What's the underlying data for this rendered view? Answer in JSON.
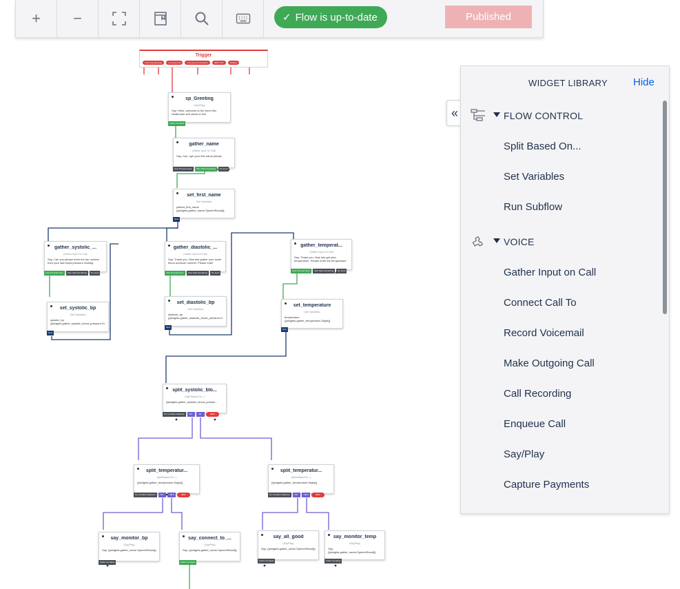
{
  "toolbar": {
    "buttons": [
      "zoom-in",
      "zoom-out",
      "fit-to-screen",
      "notes",
      "search",
      "keyboard-shortcuts"
    ],
    "zoom_in_glyph": "+",
    "zoom_out_glyph": "−",
    "status_check": "✓",
    "status": "Flow is up-to-date",
    "publish_label": "Published",
    "status_color": "#3fa956",
    "publish_color": "#eeb2b5"
  },
  "trigger": {
    "title": "Trigger",
    "ports": [
      "Incoming Message",
      "Incoming Call",
      "Incoming Conversation",
      "REST API",
      "Subflow"
    ]
  },
  "nodes": {
    "sp_greeting": {
      "title": "sp_Greeting",
      "type": "(Say/Play)",
      "body": "Say: Hello, welcome to the Next Gen Healthcare self check-in line",
      "ports": [
        "Audio Complete"
      ]
    },
    "gather_name": {
      "title": "gather_name",
      "type": "(Gather Input On Call)",
      "body": "Say: Can I get your first name please",
      "ports": [
        "User Pressed Keys",
        "User Said Something",
        "No Input"
      ]
    },
    "set_first_name": {
      "title": "set_first_name",
      "type": "(Set Variables)",
      "body": "patient_first_name {{widgets.gather_name.SpeechResult}}",
      "ports": [
        "Next"
      ]
    },
    "gather_systolic": {
      "title": "gather_systolic_...",
      "type": "(Gather Input On Call)",
      "body": "Say: Can you please enter the top number from your last blood pressure reading",
      "ports": [
        "User Pressed Keys",
        "User Said Something",
        "No Input"
      ]
    },
    "gather_diastolic": {
      "title": "gather_diastolic_...",
      "type": "(Gather Input On Call)",
      "body": "Say: Thank you. Now lets gather your lower blood pressure number. Please enter",
      "ports": [
        "User Pressed Keys",
        "User Said Something",
        "No Input"
      ]
    },
    "gather_temperature": {
      "title": "gather_temperat...",
      "type": "(Gather Input On Call)",
      "body": "Say: Thank you. Now lets get your temperature. Please enter the temperature",
      "ports": [
        "User Pressed Keys",
        "User Said Something",
        "No Input"
      ]
    },
    "set_systolic_bp": {
      "title": "set_systolic_bp",
      "type": "(Set Variables)",
      "body": "systolic_bp {{widgets.gather_systolic_blood_pressure.Di",
      "ports": [
        "Next"
      ]
    },
    "set_diastolic_bp": {
      "title": "set_diastolic_bp",
      "type": "(Set Variables)",
      "body": "diastolic_bp {{widgets.gather_diastolic_blood_pressure.D",
      "ports": [
        "Next"
      ]
    },
    "set_temperature": {
      "title": "set_temperature",
      "type": "(Set Variables)",
      "body": "temperature {{widgets.gather_temperature.Digits}}",
      "ports": [
        "Next"
      ]
    },
    "split_systolic": {
      "title": "split_systolic_blo...",
      "type": "(Split Based On...)",
      "body": "{{widgets.gather_systolic_blood_pressur...",
      "ports": [
        "No Condition Matches",
        "&lt;90...",
        "&gt;90...",
        "NEW"
      ]
    },
    "split_temp_left": {
      "title": "split_temperatur...",
      "type": "(Split Based On...)",
      "body": "{{widgets.gather_temperature.Digits}}",
      "ports": [
        "No Condition Matches",
        "&lt;98...",
        "&gt;98.6",
        "NEW"
      ]
    },
    "split_temp_right": {
      "title": "split_temperatur...",
      "type": "(Split Based On...)",
      "body": "{{widgets.gather_temperature.Digits}}",
      "ports": [
        "No Condition Matches",
        "&lt;98...",
        "&gt;98.6",
        "NEW"
      ]
    },
    "say_monitor_bp": {
      "title": "say_monitor_bp",
      "type": "(Say/Play)",
      "body": "Say: {{widgets.gather_name.SpeechResult}}",
      "ports": [
        "Audio Complete"
      ]
    },
    "say_connect_to": {
      "title": "say_connect_to_...",
      "type": "(Say/Play)",
      "body": "Say: {{widgets.gather_name.SpeechResult}}",
      "ports": [
        "Audio Complete"
      ]
    },
    "say_all_good": {
      "title": "say_all_good",
      "type": "(Say/Play)",
      "body": "Say: {{widgets.gather_name.SpeechResult}}",
      "ports": [
        "Audio Complete"
      ]
    },
    "say_monitor_temp": {
      "title": "say_monitor_temp",
      "type": "(Say/Play)",
      "body": "Say: {{widgets.gather_name.SpeechResult}}",
      "ports": [
        "Audio Complete"
      ]
    }
  },
  "library": {
    "title": "WIDGET LIBRARY",
    "hide_label": "Hide",
    "collapse_glyph": "«",
    "sections": [
      {
        "label": "FLOW CONTROL",
        "icon": "flow-control-icon",
        "items": [
          "Split Based On...",
          "Set Variables",
          "Run Subflow"
        ]
      },
      {
        "label": "VOICE",
        "icon": "phone-icon",
        "items": [
          "Gather Input on Call",
          "Connect Call To",
          "Record Voicemail",
          "Make Outgoing Call",
          "Call Recording",
          "Enqueue Call",
          "Say/Play",
          "Capture Payments"
        ]
      }
    ]
  }
}
